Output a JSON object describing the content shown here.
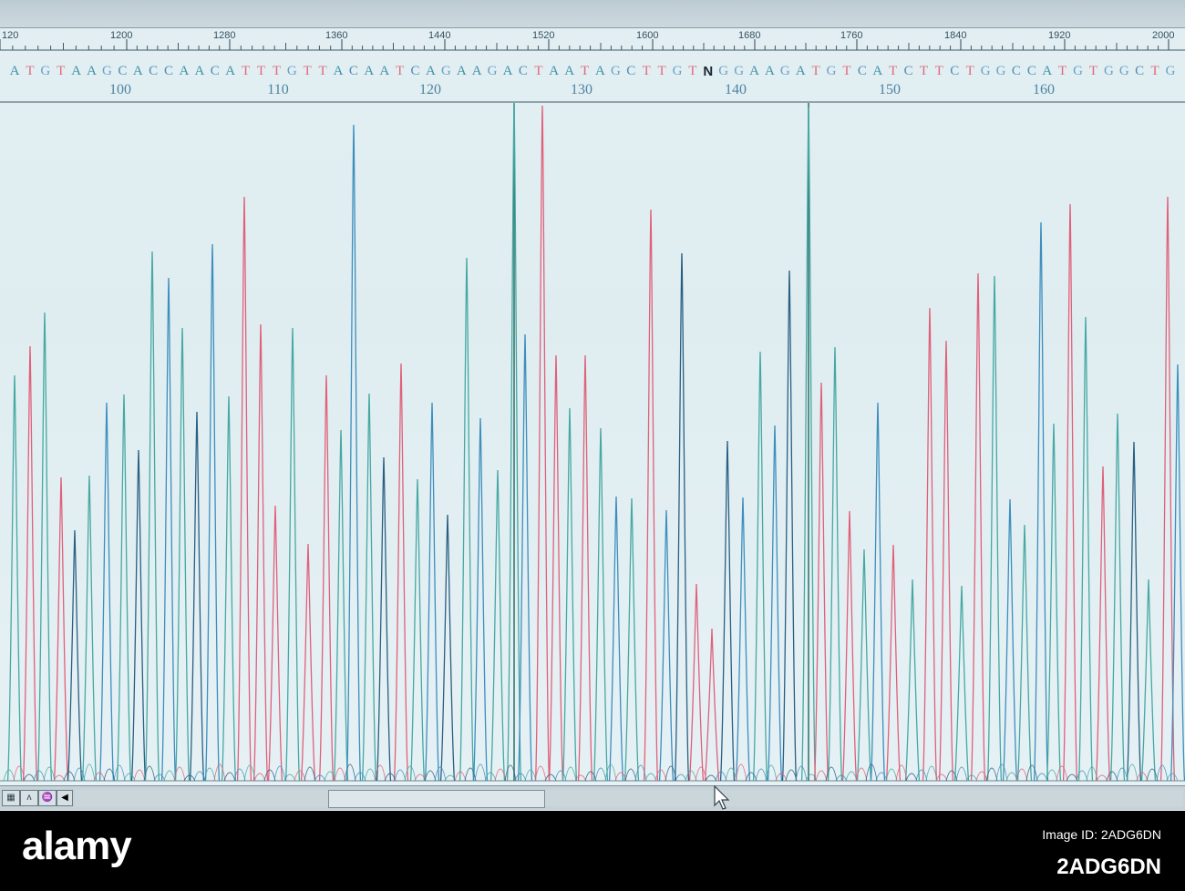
{
  "ruler": {
    "ticks": [
      "120",
      "1200",
      "1280",
      "1360",
      "1440",
      "1520",
      "1600",
      "1680",
      "1760",
      "1840",
      "1920",
      "2000"
    ]
  },
  "sequence": {
    "bases": [
      "A",
      "T",
      "G",
      "T",
      "A",
      "A",
      "G",
      "C",
      "A",
      "C",
      "C",
      "A",
      "A",
      "C",
      "A",
      "T",
      "T",
      "T",
      "G",
      "T",
      "T",
      "A",
      "C",
      "A",
      "A",
      "T",
      "C",
      "A",
      "G",
      "A",
      "A",
      "G",
      "A",
      "C",
      "T",
      "A",
      "A",
      "T",
      "A",
      "G",
      "C",
      "T",
      "T",
      "G",
      "T",
      "N",
      "G",
      "G",
      "A",
      "A",
      "G",
      "A",
      "T",
      "G",
      "T",
      "C",
      "A",
      "T",
      "C",
      "T",
      "T",
      "C",
      "T",
      "G",
      "G",
      "C",
      "C",
      "A",
      "T",
      "G",
      "T",
      "G",
      "G",
      "C",
      "T",
      "G"
    ],
    "positions": [
      "100",
      "110",
      "120",
      "130",
      "140",
      "150",
      "160"
    ],
    "colors": {
      "A": "#3f93a8",
      "T": "#dd6b7e",
      "G": "#6aa2c8",
      "C": "#4f8fb3",
      "N": "#1a2630"
    }
  },
  "trace": {
    "colors": {
      "A": "#46a8a2",
      "T": "#e0607a",
      "G": "#2a5f82",
      "C": "#3c8ebd"
    }
  },
  "scrollbar": {
    "icons": [
      "▦",
      "ʌ",
      "♒"
    ],
    "left_arrow": "◀"
  },
  "watermark": {
    "logo": "alamy",
    "stock_line": "Image ID: 2ADG6DN",
    "image_id": "2ADG6DN"
  }
}
